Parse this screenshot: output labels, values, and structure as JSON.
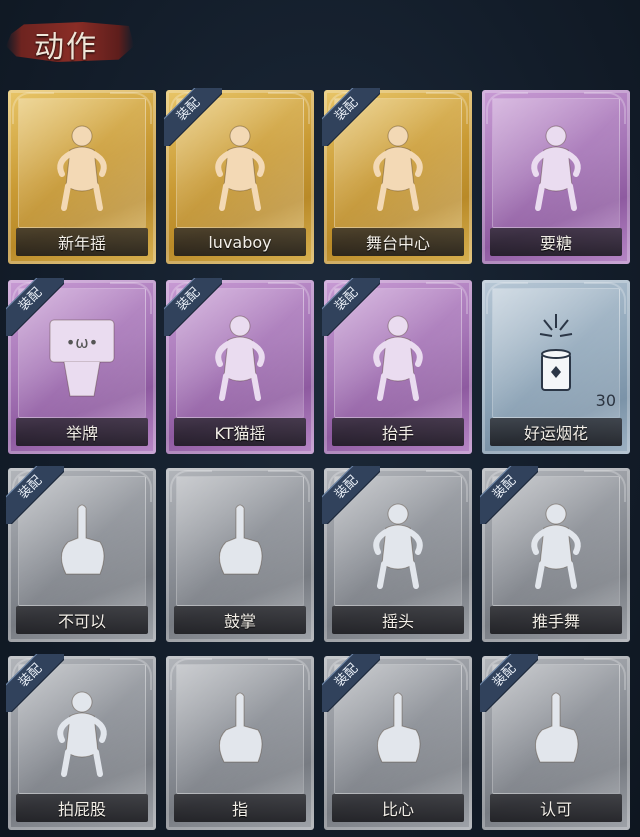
{
  "header": {
    "title": "动作"
  },
  "badge_text": "装配",
  "colors": {
    "gold": "#d3a843",
    "purple": "#a676b7",
    "blue": "#8fa6b9",
    "gray": "#8b8f96",
    "ribbon": "#31425c"
  },
  "cards": [
    {
      "label": "新年摇",
      "rarity": "gold",
      "equipped": false,
      "icon": "shy-dance-icon"
    },
    {
      "label": "luvaboy",
      "rarity": "gold",
      "equipped": true,
      "icon": "pose-icon"
    },
    {
      "label": "舞台中心",
      "rarity": "gold",
      "equipped": true,
      "icon": "center-stage-icon"
    },
    {
      "label": "要糖",
      "rarity": "purple",
      "equipped": false,
      "icon": "ask-candy-icon"
    },
    {
      "label": "举牌",
      "rarity": "purple",
      "equipped": true,
      "icon": "hold-sign-icon"
    },
    {
      "label": "KT猫摇",
      "rarity": "purple",
      "equipped": true,
      "icon": "cat-dance-icon"
    },
    {
      "label": "抬手",
      "rarity": "purple",
      "equipped": true,
      "icon": "raise-hand-icon"
    },
    {
      "label": "好运烟花",
      "rarity": "blue",
      "equipped": false,
      "icon": "firework-icon",
      "count": "30"
    },
    {
      "label": "不可以",
      "rarity": "gray",
      "equipped": true,
      "icon": "finger-wag-icon"
    },
    {
      "label": "鼓掌",
      "rarity": "gray",
      "equipped": false,
      "icon": "clap-icon"
    },
    {
      "label": "摇头",
      "rarity": "gray",
      "equipped": true,
      "icon": "shake-head-icon"
    },
    {
      "label": "推手舞",
      "rarity": "gray",
      "equipped": true,
      "icon": "push-dance-icon"
    },
    {
      "label": "拍屁股",
      "rarity": "gray",
      "equipped": true,
      "icon": "pat-icon"
    },
    {
      "label": "指",
      "rarity": "gray",
      "equipped": false,
      "icon": "point-icon"
    },
    {
      "label": "比心",
      "rarity": "gray",
      "equipped": true,
      "icon": "finger-heart-icon"
    },
    {
      "label": "认可",
      "rarity": "gray",
      "equipped": true,
      "icon": "thumbs-up-icon"
    }
  ]
}
